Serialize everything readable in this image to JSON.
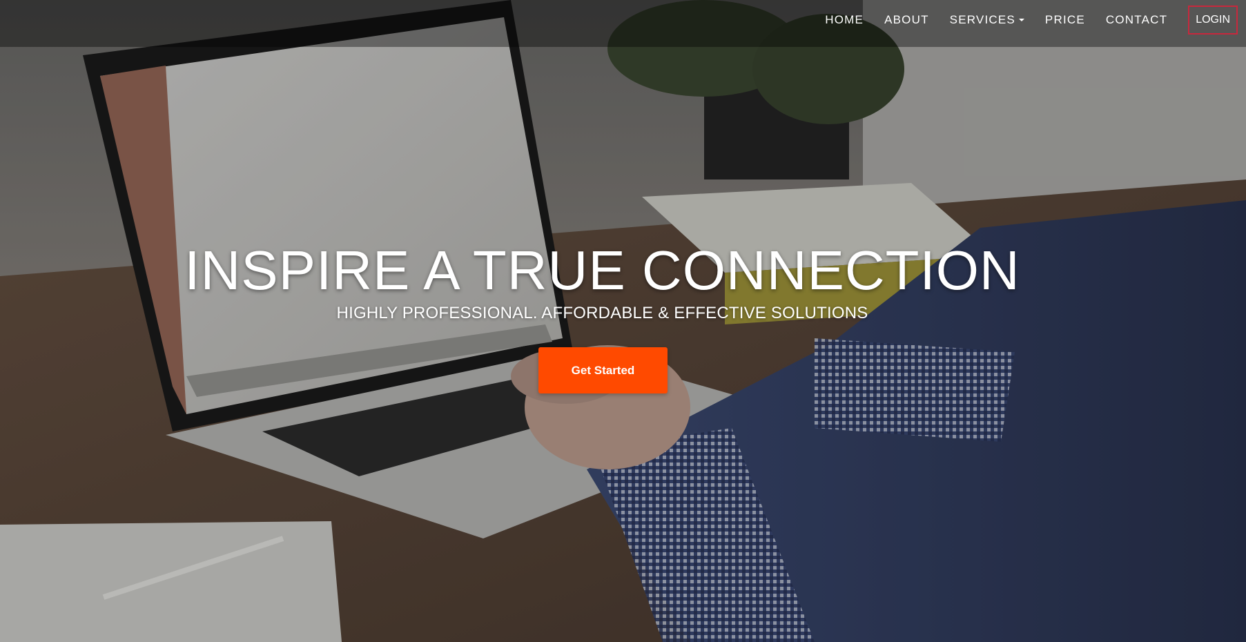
{
  "nav": {
    "items": [
      {
        "label": "HOME"
      },
      {
        "label": "ABOUT"
      },
      {
        "label": "SERVICES"
      },
      {
        "label": "PRICE"
      },
      {
        "label": "CONTACT"
      }
    ],
    "login_label": "LOGIN"
  },
  "hero": {
    "title": "INSPIRE A TRUE CONNECTION",
    "subtitle": "HIGHLY PROFESSIONAL. AFFORDABLE & EFFECTIVE SOLUTIONS",
    "cta_label": "Get Started",
    "background_image": "laptop-desk-photo",
    "accent_color": "#ff4a00",
    "login_border_color": "#c8283d"
  }
}
